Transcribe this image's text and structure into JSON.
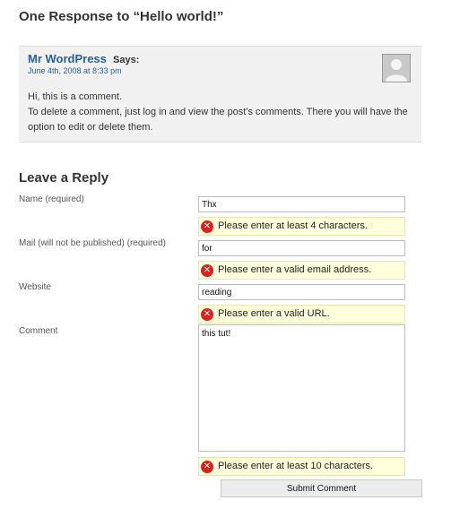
{
  "responses_heading": "One Response to “Hello world!”",
  "comment": {
    "author": "Mr WordPress",
    "says": "Says:",
    "date": "June 4th, 2008 at 8:33 pm",
    "avatar_icon": "user-avatar-icon",
    "lines": [
      "Hi, this is a comment.",
      "To delete a comment, just log in and view the post's comments. There you will have the option to edit or delete them."
    ]
  },
  "reply": {
    "heading": "Leave a Reply",
    "name": {
      "label": "Name (required)",
      "value": "Thx",
      "error": "Please enter at least 4 characters."
    },
    "mail": {
      "label": "Mail (will not be published) (required)",
      "value": "for",
      "error": "Please enter a valid email address."
    },
    "website": {
      "label": "Website",
      "value": "reading",
      "error": "Please enter a valid URL."
    },
    "comment": {
      "label": "Comment",
      "value": "this tut!",
      "error": "Please enter at least 10 characters."
    },
    "submit_label": "Submit Comment",
    "error_icon": "error-x-icon",
    "colors": {
      "error_bg": "#ffffdc",
      "error_icon": "#d8231f",
      "link": "#2361a1"
    }
  }
}
